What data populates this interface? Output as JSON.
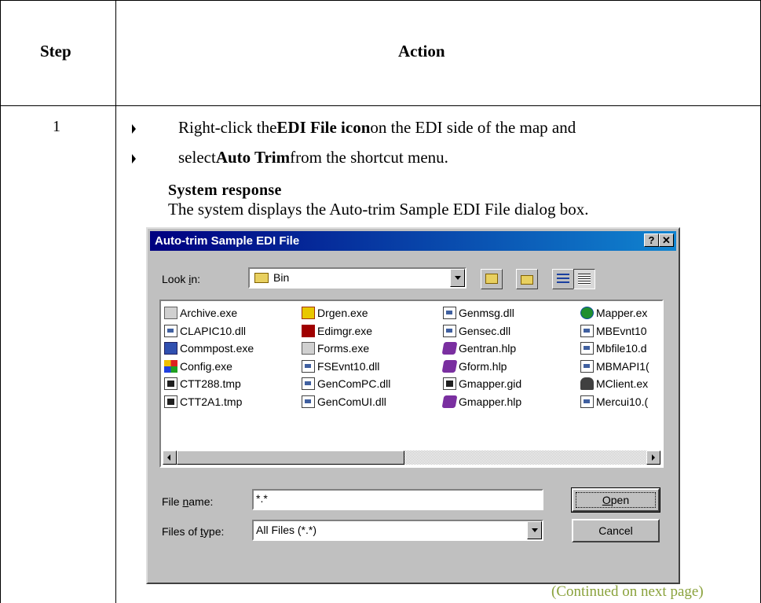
{
  "table": {
    "header_step": "Step",
    "header_action": "Action",
    "step_number": "1",
    "bullet1": {
      "before": "Right-click the ",
      "bold": "EDI File icon",
      "after": " on the EDI side of the map and"
    },
    "bullet2": {
      "before": "select ",
      "bold": "Auto Trim",
      "after": " from the shortcut menu."
    },
    "system_response_title": "System response",
    "system_response_text": "The system displays the Auto-trim Sample EDI File dialog box.",
    "continued": "(Continued on next page)"
  },
  "dialog": {
    "title": "Auto-trim Sample EDI File",
    "help_button": "?",
    "close_button": "✕",
    "look_in_label": {
      "pre": "Look ",
      "u": "i",
      "post": "n:"
    },
    "look_in_value": "Bin",
    "files": [
      [
        {
          "name": "Archive.exe",
          "icon": "exe"
        },
        {
          "name": "CLAPIC10.dll",
          "icon": "dll"
        },
        {
          "name": "Commpost.exe",
          "icon": "pc"
        },
        {
          "name": "Config.exe",
          "icon": "win"
        },
        {
          "name": "CTT288.tmp",
          "icon": "tmp"
        },
        {
          "name": "CTT2A1.tmp",
          "icon": "tmp"
        }
      ],
      [
        {
          "name": "Drgen.exe",
          "icon": "mail"
        },
        {
          "name": "Edimgr.exe",
          "icon": "redx"
        },
        {
          "name": "Forms.exe",
          "icon": "exe"
        },
        {
          "name": "FSEvnt10.dll",
          "icon": "dll"
        },
        {
          "name": "GenComPC.dll",
          "icon": "dll"
        },
        {
          "name": "GenComUI.dll",
          "icon": "dll"
        }
      ],
      [
        {
          "name": "Genmsg.dll",
          "icon": "dll"
        },
        {
          "name": "Gensec.dll",
          "icon": "dll"
        },
        {
          "name": "Gentran.hlp",
          "icon": "hlp"
        },
        {
          "name": "Gform.hlp",
          "icon": "hlp"
        },
        {
          "name": "Gmapper.gid",
          "icon": "tmp"
        },
        {
          "name": "Gmapper.hlp",
          "icon": "hlp"
        }
      ],
      [
        {
          "name": "Mapper.ex",
          "icon": "globe"
        },
        {
          "name": "MBEvnt10",
          "icon": "dll"
        },
        {
          "name": "Mbfile10.d",
          "icon": "dll"
        },
        {
          "name": "MBMAPI1(",
          "icon": "dll"
        },
        {
          "name": "MClient.ex",
          "icon": "client"
        },
        {
          "name": "Mercui10.(",
          "icon": "dll"
        }
      ]
    ],
    "file_name_label": {
      "pre": "File ",
      "u": "n",
      "post": "ame:"
    },
    "file_name_value": "*.*",
    "files_of_type_label": {
      "pre": "Files of ",
      "u": "t",
      "post": "ype:"
    },
    "files_of_type_value": "All Files (*.*)",
    "open_button": {
      "u": "O",
      "post": "pen"
    },
    "cancel_button": "Cancel"
  }
}
